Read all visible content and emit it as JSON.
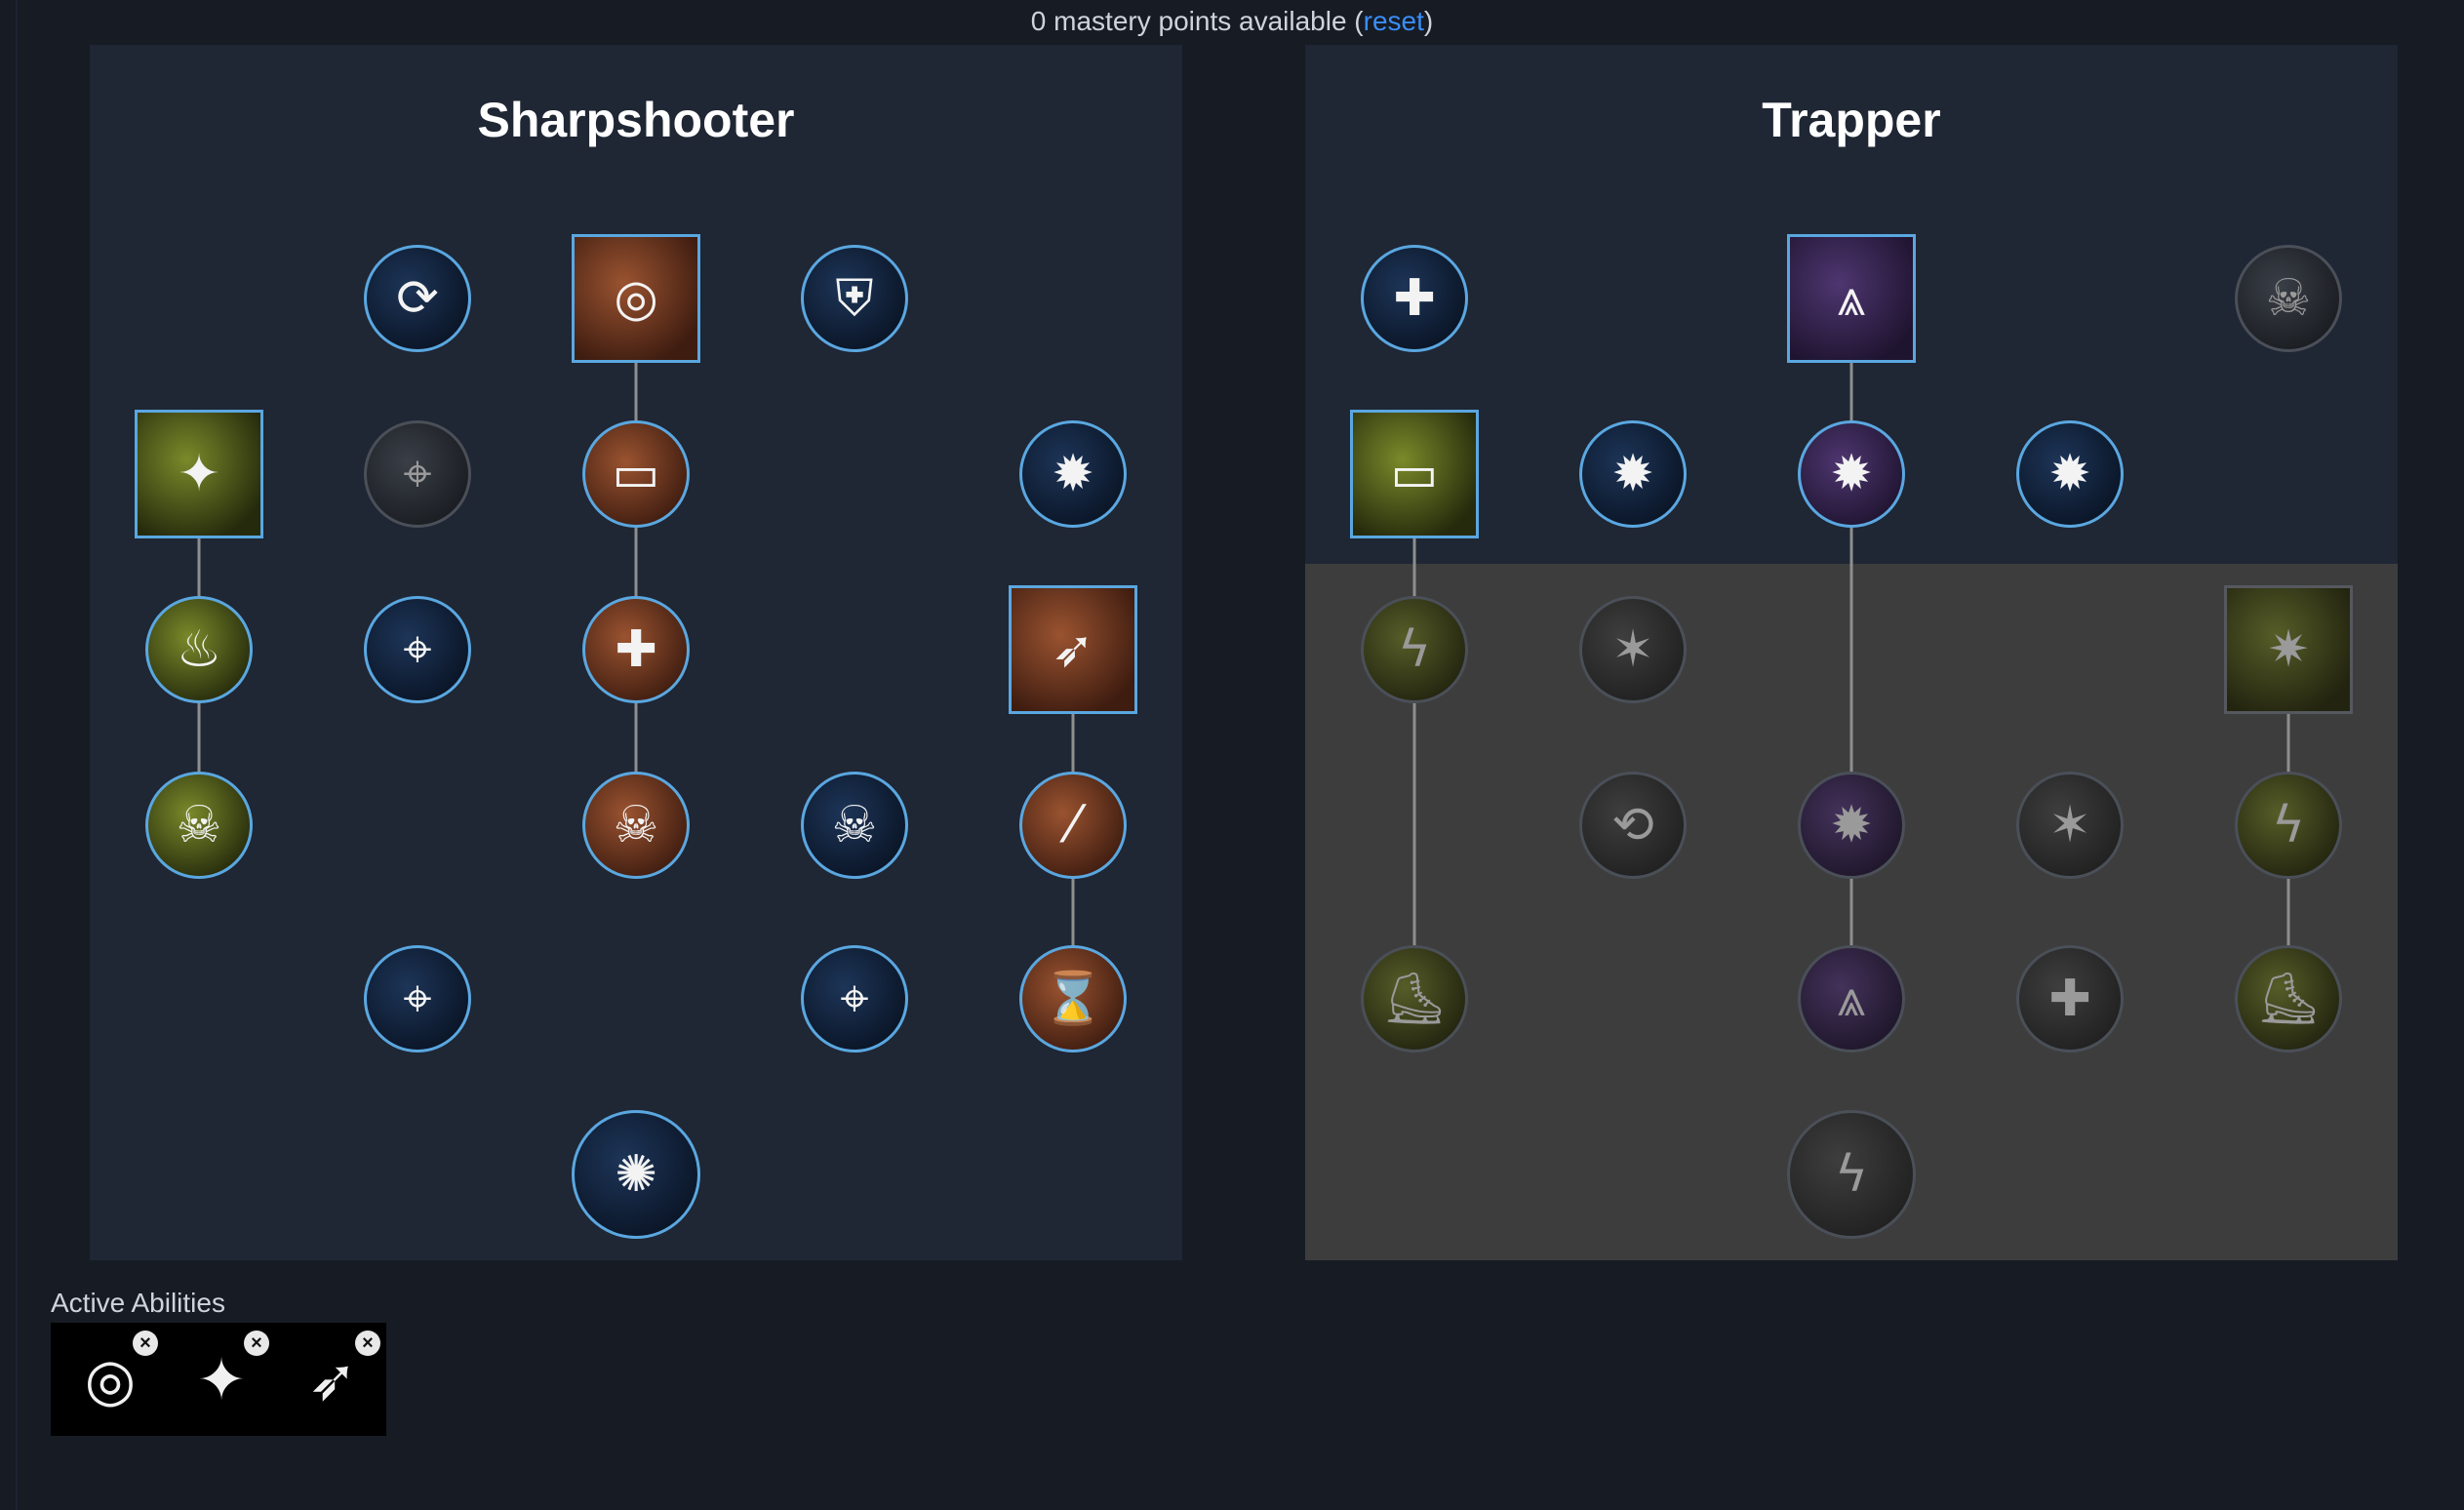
{
  "header": {
    "points_text": "0 mastery points available (",
    "reset_label": "reset",
    "close_paren": ")"
  },
  "trees": [
    {
      "title": "Sharpshooter",
      "nodes": [
        {
          "id": "s1",
          "row": 0,
          "col": 1,
          "shape": "circle",
          "style": "navy",
          "icon": "ammo-refresh-icon",
          "glyph": "⟳"
        },
        {
          "id": "s2",
          "row": 0,
          "col": 2,
          "shape": "square",
          "style": "brown",
          "icon": "rotating-target-icon",
          "glyph": "◎"
        },
        {
          "id": "s3",
          "row": 0,
          "col": 3,
          "shape": "circle",
          "style": "navy",
          "icon": "armor-vest-icon",
          "glyph": "⛨"
        },
        {
          "id": "s4",
          "row": 1,
          "col": 0,
          "shape": "square",
          "style": "olive",
          "icon": "sparkle-flame-icon",
          "glyph": "✦"
        },
        {
          "id": "s5",
          "row": 1,
          "col": 1,
          "shape": "circle",
          "style": "dark",
          "icon": "crosshair-icon",
          "glyph": "⌖",
          "locked": true
        },
        {
          "id": "s6",
          "row": 1,
          "col": 2,
          "shape": "circle",
          "style": "brown",
          "icon": "bullet-icon",
          "glyph": "▭"
        },
        {
          "id": "s7",
          "row": 1,
          "col": 4,
          "shape": "circle",
          "style": "navy",
          "icon": "target-head-icon",
          "glyph": "✹"
        },
        {
          "id": "s8",
          "row": 2,
          "col": 0,
          "shape": "circle",
          "style": "olive",
          "icon": "fire-icon",
          "glyph": "♨"
        },
        {
          "id": "s9",
          "row": 2,
          "col": 1,
          "shape": "circle",
          "style": "navy",
          "icon": "crosshair-range-icon",
          "glyph": "⌖"
        },
        {
          "id": "s10",
          "row": 2,
          "col": 2,
          "shape": "circle",
          "style": "brown",
          "icon": "health-plus-icon",
          "glyph": "✚"
        },
        {
          "id": "s11",
          "row": 2,
          "col": 4,
          "shape": "square",
          "style": "brown",
          "icon": "kneeling-shooter-icon",
          "glyph": "➶"
        },
        {
          "id": "s12",
          "row": 3,
          "col": 0,
          "shape": "circle",
          "style": "olive",
          "icon": "skull-hourglass-icon",
          "glyph": "☠"
        },
        {
          "id": "s13",
          "row": 3,
          "col": 2,
          "shape": "circle",
          "style": "brown",
          "icon": "skull-refresh-icon",
          "glyph": "☠"
        },
        {
          "id": "s14",
          "row": 3,
          "col": 3,
          "shape": "circle",
          "style": "navy",
          "icon": "skull-refresh-icon",
          "glyph": "☠"
        },
        {
          "id": "s15",
          "row": 3,
          "col": 4,
          "shape": "circle",
          "style": "brown",
          "icon": "bullets-icon",
          "glyph": "⁄"
        },
        {
          "id": "s16",
          "row": 4,
          "col": 1,
          "shape": "circle",
          "style": "navy",
          "icon": "crosshair-range-icon",
          "glyph": "⌖"
        },
        {
          "id": "s17",
          "row": 4,
          "col": 3,
          "shape": "circle",
          "style": "navy",
          "icon": "crosshair-icon",
          "glyph": "⌖"
        },
        {
          "id": "s18",
          "row": 4,
          "col": 4,
          "shape": "circle",
          "style": "brown",
          "icon": "hourglass-target-icon",
          "glyph": "⌛"
        },
        {
          "id": "s19",
          "row": 5,
          "col": 2,
          "shape": "circle",
          "style": "navy",
          "icon": "crosshair-burst-icon",
          "glyph": "✺",
          "big": true
        }
      ],
      "links": [
        [
          "s2",
          "s6"
        ],
        [
          "s6",
          "s10"
        ],
        [
          "s10",
          "s13"
        ],
        [
          "s4",
          "s8"
        ],
        [
          "s8",
          "s12"
        ],
        [
          "s11",
          "s15"
        ],
        [
          "s15",
          "s18"
        ]
      ]
    },
    {
      "title": "Trapper",
      "nodes": [
        {
          "id": "t1",
          "row": 0,
          "col": 0,
          "shape": "circle",
          "style": "navy",
          "icon": "medic-cross-icon",
          "glyph": "✚"
        },
        {
          "id": "t2",
          "row": 0,
          "col": 2,
          "shape": "square",
          "style": "purple",
          "icon": "spike-trap-icon",
          "glyph": "⩓"
        },
        {
          "id": "t3",
          "row": 0,
          "col": 4,
          "shape": "circle",
          "style": "dark",
          "icon": "skull-icon",
          "glyph": "☠",
          "locked": true
        },
        {
          "id": "t4",
          "row": 1,
          "col": 0,
          "shape": "square",
          "style": "olive",
          "icon": "bullet-impact-icon",
          "glyph": "▭"
        },
        {
          "id": "t5",
          "row": 1,
          "col": 1,
          "shape": "circle",
          "style": "navy",
          "icon": "shield-burst-icon",
          "glyph": "✹"
        },
        {
          "id": "t6",
          "row": 1,
          "col": 2,
          "shape": "circle",
          "style": "purple",
          "icon": "spike-burst-icon",
          "glyph": "✹"
        },
        {
          "id": "t7",
          "row": 1,
          "col": 3,
          "shape": "circle",
          "style": "navy",
          "icon": "shield-burst-icon",
          "glyph": "✹"
        },
        {
          "id": "t8",
          "row": 2,
          "col": 0,
          "shape": "circle",
          "style": "olive-dim",
          "icon": "lightning-icon",
          "glyph": "ϟ",
          "locked": true
        },
        {
          "id": "t9",
          "row": 2,
          "col": 1,
          "shape": "circle",
          "style": "greydark",
          "icon": "tripwire-runner-icon",
          "glyph": "✶",
          "locked": true
        },
        {
          "id": "t10",
          "row": 2,
          "col": 4,
          "shape": "square",
          "style": "olive-dim",
          "icon": "spike-mine-icon",
          "glyph": "✷",
          "locked": true
        },
        {
          "id": "t11",
          "row": 3,
          "col": 1,
          "shape": "circle",
          "style": "greydark",
          "icon": "boot-refresh-icon",
          "glyph": "⟲",
          "locked": true
        },
        {
          "id": "t12",
          "row": 3,
          "col": 2,
          "shape": "circle",
          "style": "purple-dim",
          "icon": "spike-burst-icon",
          "glyph": "✹",
          "locked": true
        },
        {
          "id": "t13",
          "row": 3,
          "col": 3,
          "shape": "circle",
          "style": "greydark",
          "icon": "tripwire-runner-icon",
          "glyph": "✶",
          "locked": true
        },
        {
          "id": "t14",
          "row": 3,
          "col": 4,
          "shape": "circle",
          "style": "olive-dim",
          "icon": "lightning-icon",
          "glyph": "ϟ",
          "locked": true
        },
        {
          "id": "t15",
          "row": 4,
          "col": 0,
          "shape": "circle",
          "style": "olive-dim",
          "icon": "boot-icon",
          "glyph": "⛸",
          "locked": true
        },
        {
          "id": "t16",
          "row": 4,
          "col": 2,
          "shape": "circle",
          "style": "purple-dim",
          "icon": "spike-trap-icon",
          "glyph": "⩓",
          "locked": true
        },
        {
          "id": "t17",
          "row": 4,
          "col": 3,
          "shape": "circle",
          "style": "greydark",
          "icon": "health-plus-icon",
          "glyph": "✚",
          "locked": true
        },
        {
          "id": "t18",
          "row": 4,
          "col": 4,
          "shape": "circle",
          "style": "olive-dim",
          "icon": "boot-icon",
          "glyph": "⛸",
          "locked": true
        },
        {
          "id": "t19",
          "row": 5,
          "col": 2,
          "shape": "circle",
          "style": "greydark",
          "icon": "shock-group-icon",
          "glyph": "ϟ",
          "locked": true,
          "big": true
        }
      ],
      "links": [
        [
          "t2",
          "t6"
        ],
        [
          "t6",
          "t12"
        ],
        [
          "t12",
          "t16"
        ],
        [
          "t4",
          "t8"
        ],
        [
          "t8",
          "t15"
        ],
        [
          "t10",
          "t14"
        ],
        [
          "t14",
          "t18"
        ]
      ]
    }
  ],
  "active_abilities": {
    "label": "Active Abilities",
    "slots": [
      {
        "icon": "rotating-target-icon",
        "glyph": "◎"
      },
      {
        "icon": "sparkle-flame-icon",
        "glyph": "✦"
      },
      {
        "icon": "kneeling-shooter-icon",
        "glyph": "➶"
      }
    ],
    "remove_glyph": "×"
  },
  "colors": {
    "background": "#161b24",
    "panel": "#1f2634",
    "locked_area": "#3d3d3d",
    "border_active": "#5aa7e0",
    "link": "#8e8e8e",
    "reset_link": "#3a8ef6"
  }
}
